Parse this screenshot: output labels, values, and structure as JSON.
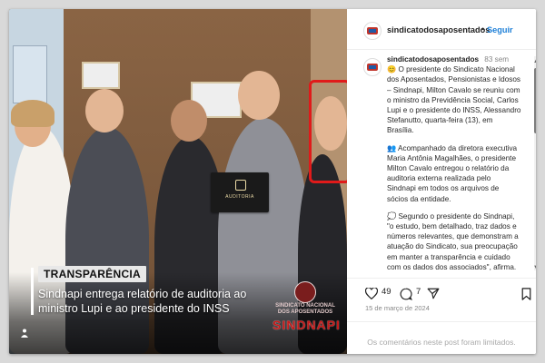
{
  "post": {
    "category_tag": "TRANSPARÊNCIA",
    "headline": "Sindnapi entrega relatório de auditoria ao ministro Lupi e ao presidente do INSS",
    "box_label": "AUDITORIA",
    "logo_text": "SINDNAPI",
    "logo_subtext": "SINDICATO NACIONAL DOS APOSENTADOS"
  },
  "header": {
    "username": "sindicatodosaposentados",
    "separator": "•",
    "follow_label": "Seguir"
  },
  "caption": {
    "username": "sindicatodosaposentados",
    "time_ago": "83 sem",
    "paragraphs": [
      "😊 O presidente do Sindicato Nacional dos Aposentados, Pensionistas e Idosos – Sindnapi, Milton Cavalo se reuniu com o ministro da Previdência Social, Carlos Lupi e o presidente do INSS, Alessandro Stefanutto, quarta-feira (13), em Brasília.",
      "👥 Acompanhado da diretora executiva Maria Antônia Magalhães, o presidente Milton Cavalo entregou o relatório da auditoria externa realizada pelo Sindnapi em todos os arquivos de sócios da entidade.",
      "💭 Segundo o presidente do Sindnapi, \"o estudo, bem detalhado, traz dados e números relevantes, que demonstram a atuação do Sindicato, sua preocupação em manter a transparência e cuidado com os dados dos associados\", afirma."
    ]
  },
  "actions": {
    "likes_count": "49",
    "comments_count": "7"
  },
  "date": "15 de março de 2024",
  "comments_notice": "Os comentários neste post foram limitados.",
  "colors": {
    "follow": "#1d7fd7",
    "highlight": "#e01a1a",
    "brand_red": "#c51919"
  }
}
